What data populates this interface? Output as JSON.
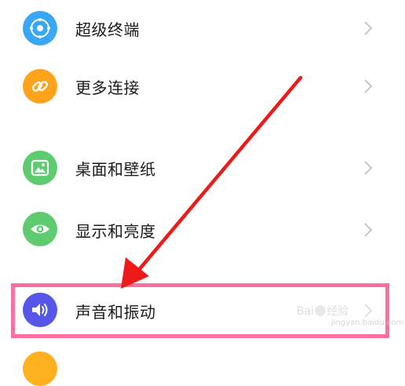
{
  "settings_list": {
    "items": [
      {
        "label": "超级终端",
        "icon": "super-terminal-icon",
        "color": "#3aa7f5"
      },
      {
        "label": "更多连接",
        "icon": "link-icon",
        "color": "#ffa31a"
      },
      {
        "label": "桌面和壁纸",
        "icon": "wallpaper-icon",
        "color": "#5fcb70"
      },
      {
        "label": "显示和亮度",
        "icon": "eye-icon",
        "color": "#5fcb70"
      },
      {
        "label": "声音和振动",
        "icon": "speaker-icon",
        "color": "#5657e8"
      }
    ],
    "chevron_glyph": "›"
  },
  "annotation": {
    "arrow_color": "#ee1a1a",
    "highlight_color": "#ff6f9f"
  },
  "watermark": {
    "brand_prefix": "Bai",
    "brand_suffix": "经验",
    "url": "jingyan.baidu.com"
  }
}
